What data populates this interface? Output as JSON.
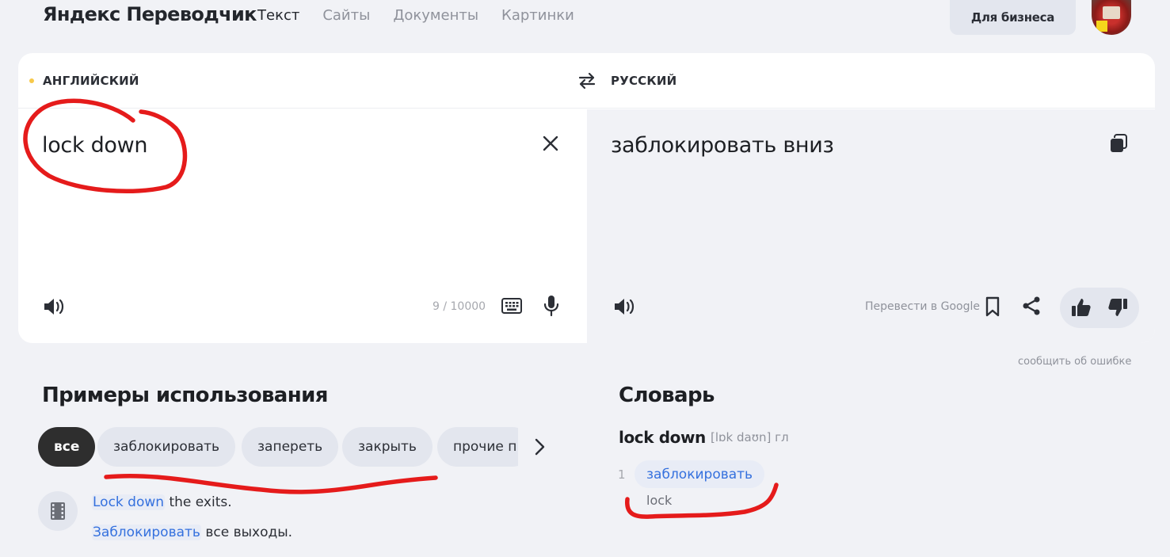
{
  "header": {
    "logo": "Яндекс Переводчик",
    "nav": [
      "Текст",
      "Сайты",
      "Документы",
      "Картинки"
    ],
    "active_nav": 0,
    "business_button": "Для бизнеса"
  },
  "translator": {
    "source_language": "АНГЛИЙСКИЙ",
    "target_language": "РУССКИЙ",
    "source_text": "lock down",
    "translation": "заблокировать вниз",
    "char_count": "9 / 10000",
    "translate_in_google": "Перевести в Google",
    "report_error": "сообщить об ошибке"
  },
  "examples": {
    "title": "Примеры использования",
    "chips": [
      "все",
      "заблокировать",
      "запереть",
      "закрыть",
      "прочие п"
    ],
    "line1_link": "Lock down",
    "line1_rest": " the exits.",
    "line2_link": "Заблокировать",
    "line2_rest": " все выходы."
  },
  "dictionary": {
    "title": "Словарь",
    "word": "lock down",
    "transcription": "[lɒk daʊn] гл",
    "entries": [
      {
        "num": "1",
        "translation": "заблокировать",
        "synonym": "lock"
      }
    ]
  },
  "colors": {
    "background": "#f1f2f6",
    "accent_blue": "#3571de",
    "annotation_red": "#e51b1b"
  },
  "icons": [
    "swap-icon",
    "clear-icon",
    "copy-icon",
    "speaker-icon",
    "keyboard-icon",
    "microphone-icon",
    "bookmark-icon",
    "share-icon",
    "thumb-up-icon",
    "thumb-down-icon",
    "chevron-right-icon",
    "film-icon"
  ]
}
